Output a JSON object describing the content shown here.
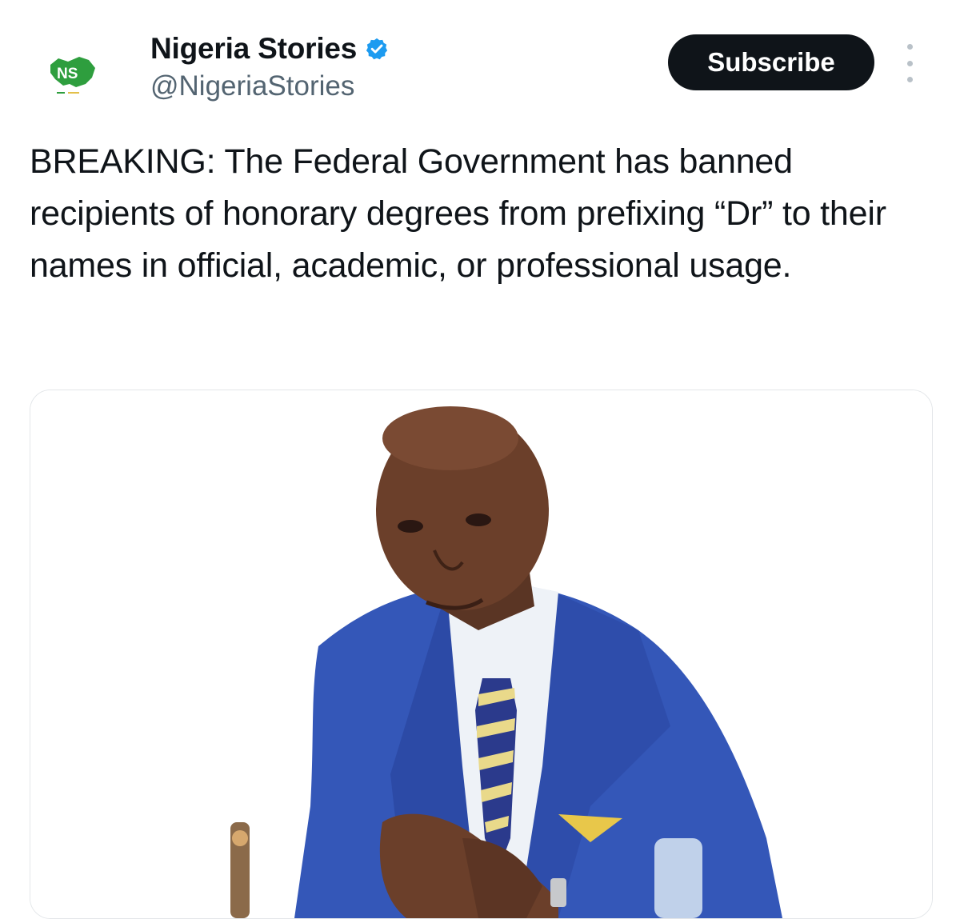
{
  "account": {
    "display_name": "Nigeria Stories",
    "handle": "@NigeriaStories",
    "verified": true,
    "avatar_logo_text": "NS",
    "avatar_icon": "nigeria-map-logo"
  },
  "actions": {
    "subscribe_label": "Subscribe",
    "more_icon": "vertical-ellipsis"
  },
  "post": {
    "text": "BREAKING: The Federal Government has banned recipients of honorary degrees from prefixing “Dr” to their names in official, academic, or professional usage."
  },
  "media": {
    "type": "photo",
    "subject": "man in blue suit with striped tie"
  },
  "colors": {
    "text_primary": "#0f1419",
    "text_secondary": "#536471",
    "verified_blue": "#1d9bf0",
    "button_bg": "#0f1419",
    "logo_green": "#2e9e3e"
  }
}
